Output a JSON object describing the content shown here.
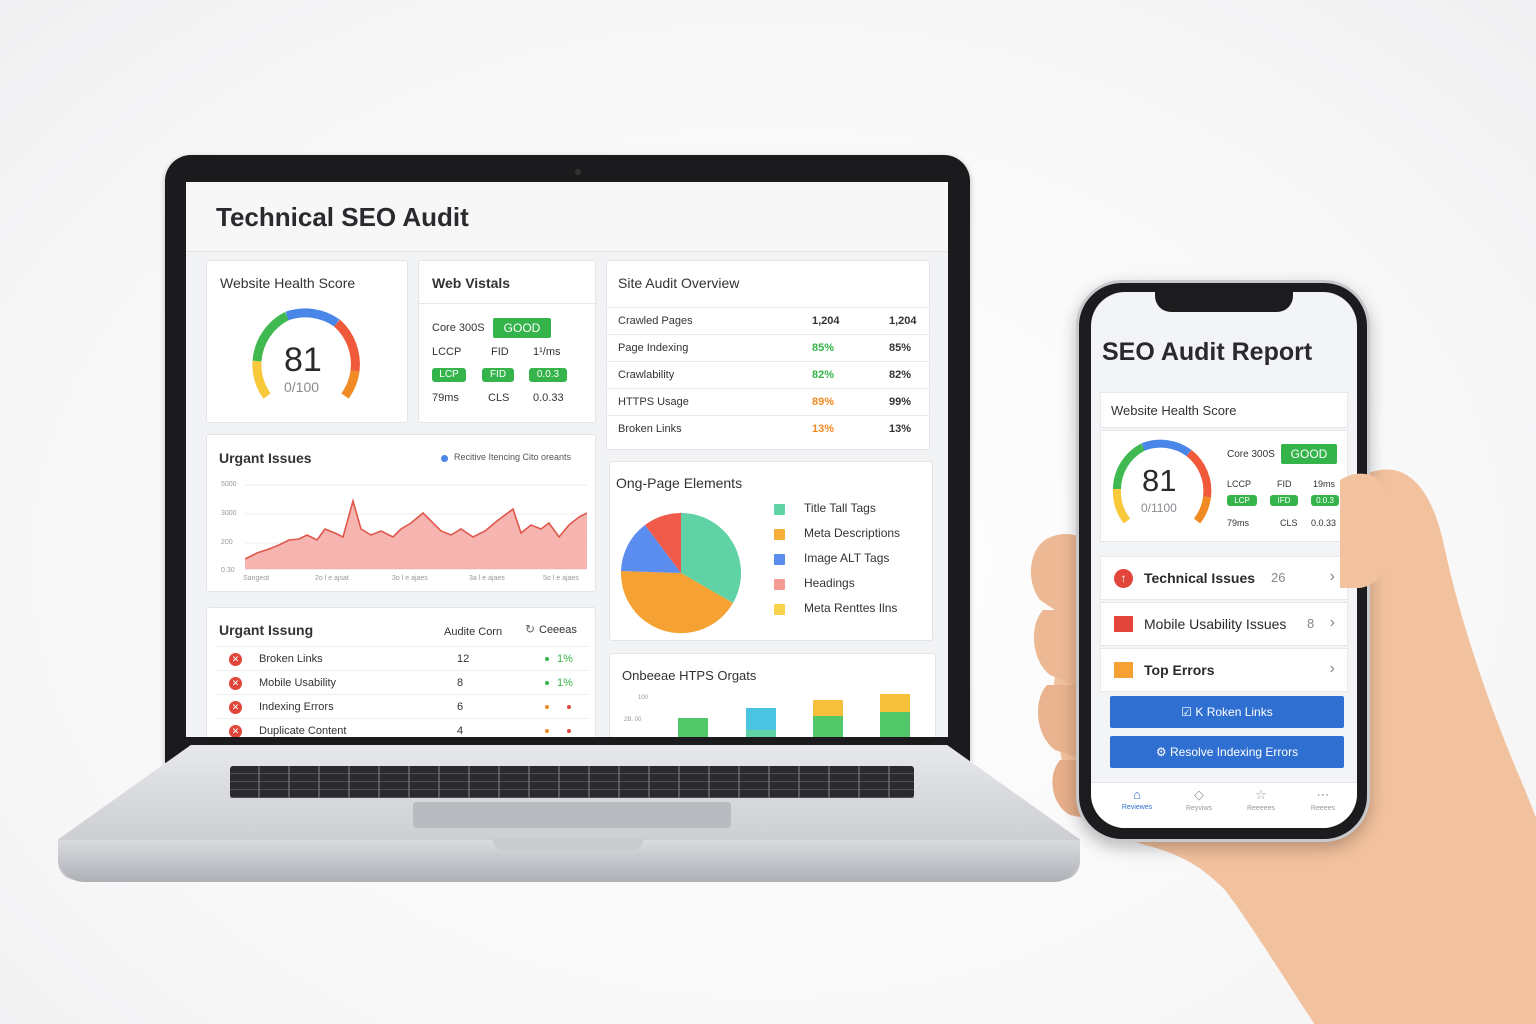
{
  "laptop": {
    "title": "Technical SEO Audit",
    "health": {
      "title": "Website Health Score",
      "score": "81",
      "sub": "0/100"
    },
    "vitals": {
      "title": "Web Vistals",
      "core_label": "Core 300S",
      "core_badge": "GOOD",
      "row1": [
        "LCCP",
        "FID",
        "1¹/ms"
      ],
      "row2_badges": [
        "LCP",
        "FID",
        "0.0.3"
      ],
      "row3": [
        "79ms",
        "CLS",
        "0.0.33"
      ]
    },
    "overview": {
      "title": "Site Audit Overview",
      "rows": [
        {
          "label": "Crawled Pages",
          "mid": "1,204",
          "right": "1,204",
          "color": "#333333"
        },
        {
          "label": "Page Indexing",
          "mid": "85%",
          "right": "85%",
          "color": "#34b44a"
        },
        {
          "label": "Crawlability",
          "mid": "82%",
          "right": "82%",
          "color": "#34b44a"
        },
        {
          "label": "HTTPS Usage",
          "mid": "89%",
          "right": "99%",
          "color": "#f08a24"
        },
        {
          "label": "Broken Links",
          "mid": "13%",
          "right": "13%",
          "color": "#f08a24"
        }
      ]
    },
    "urgent_chart": {
      "title": "Urgant Issues",
      "legend": "Recitive Itencing Cito oreants",
      "y_ticks": [
        "5000",
        "3000",
        "200",
        "0.30"
      ],
      "x_ticks": [
        "Sangeot",
        "2o l e ajsat",
        "3o l e ajaes",
        "3a l e ajaes",
        "5o l e ajaes"
      ]
    },
    "onpage": {
      "title": "Ong-Page Elements",
      "items": [
        {
          "label": "Title Tall Tags",
          "color": "#5fd3a5"
        },
        {
          "label": "Meta Descriptions",
          "color": "#f6b03a"
        },
        {
          "label": "Image  ALT Tags",
          "color": "#5b8def"
        },
        {
          "label": "Headings",
          "color": "#f59a94"
        },
        {
          "label": "Meta Renttes Ilns",
          "color": "#f8d24a"
        }
      ]
    },
    "issues_table": {
      "title": "Urgant Issung",
      "col2": "Audite Corn",
      "col3": "Ceeeas",
      "rows": [
        {
          "name": "Broken Links",
          "count": "12",
          "extra": "1%",
          "extra_color": "#34b44a"
        },
        {
          "name": "Mobile Usability",
          "count": "8",
          "extra": "1%",
          "extra_color": "#34b44a"
        },
        {
          "name": "Indexing Errors",
          "count": "6",
          "extra": "",
          "extra_color": "#f08a24"
        },
        {
          "name": "Duplicate Content",
          "count": "4",
          "extra": "",
          "extra_color": "#f08a24"
        }
      ]
    },
    "bars": {
      "title": "Onbeeae HTPS Orgats",
      "y_ticks": [
        "100",
        "2B. 00"
      ]
    }
  },
  "phone": {
    "title": "SEO Audit Report",
    "health_title": "Website Health Score",
    "score": "81",
    "sub": "0/1100",
    "core_label": "Core 300S",
    "core_badge": "GOOD",
    "row1": [
      "LCCP",
      "FID",
      "19ms"
    ],
    "row2_badges": [
      "LCP",
      "IFD",
      "0.0.3"
    ],
    "row3": [
      "79ms",
      "CLS",
      "0.0.33"
    ],
    "items": [
      {
        "label": "Technical Issues",
        "count": "26"
      },
      {
        "label": "Mobile Usability Issues",
        "count": "8"
      },
      {
        "label": "Top Errors",
        "count": ""
      }
    ],
    "buttons": [
      "K Roken Links",
      "Resolve Indexing Errors"
    ],
    "tabs": [
      "Reviewes",
      "Reyviws",
      "Reeeees",
      "Reeees"
    ]
  }
}
